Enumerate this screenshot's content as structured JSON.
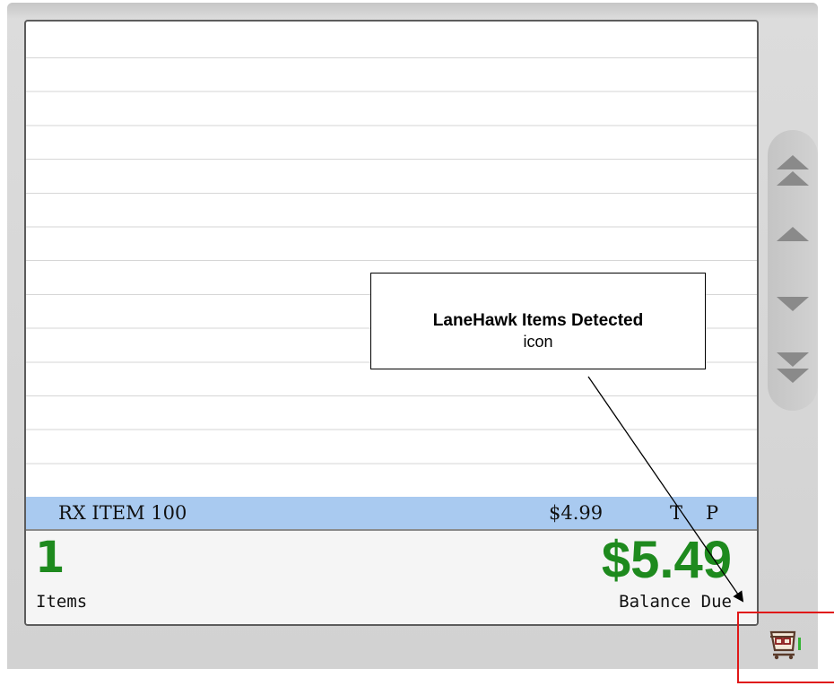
{
  "item_row": {
    "name": "RX ITEM 100",
    "price": "$4.99",
    "flag_t": "T",
    "flag_p": "P"
  },
  "totals": {
    "item_count": "1",
    "item_count_label": "Items",
    "balance": "$5.49",
    "balance_label": "Balance Due"
  },
  "callout": {
    "title": "LaneHawk Items Detected",
    "subtitle": "icon"
  },
  "scroll": {
    "icons": [
      "double-chevron-up-icon",
      "chevron-up-icon",
      "chevron-down-icon",
      "double-chevron-down-icon"
    ]
  },
  "icons": {
    "lanehawk": "shopping-cart-icon"
  },
  "colors": {
    "selected_row": "#a9caf0",
    "total_green": "#1e8a1e",
    "highlight_red": "#e01818"
  }
}
